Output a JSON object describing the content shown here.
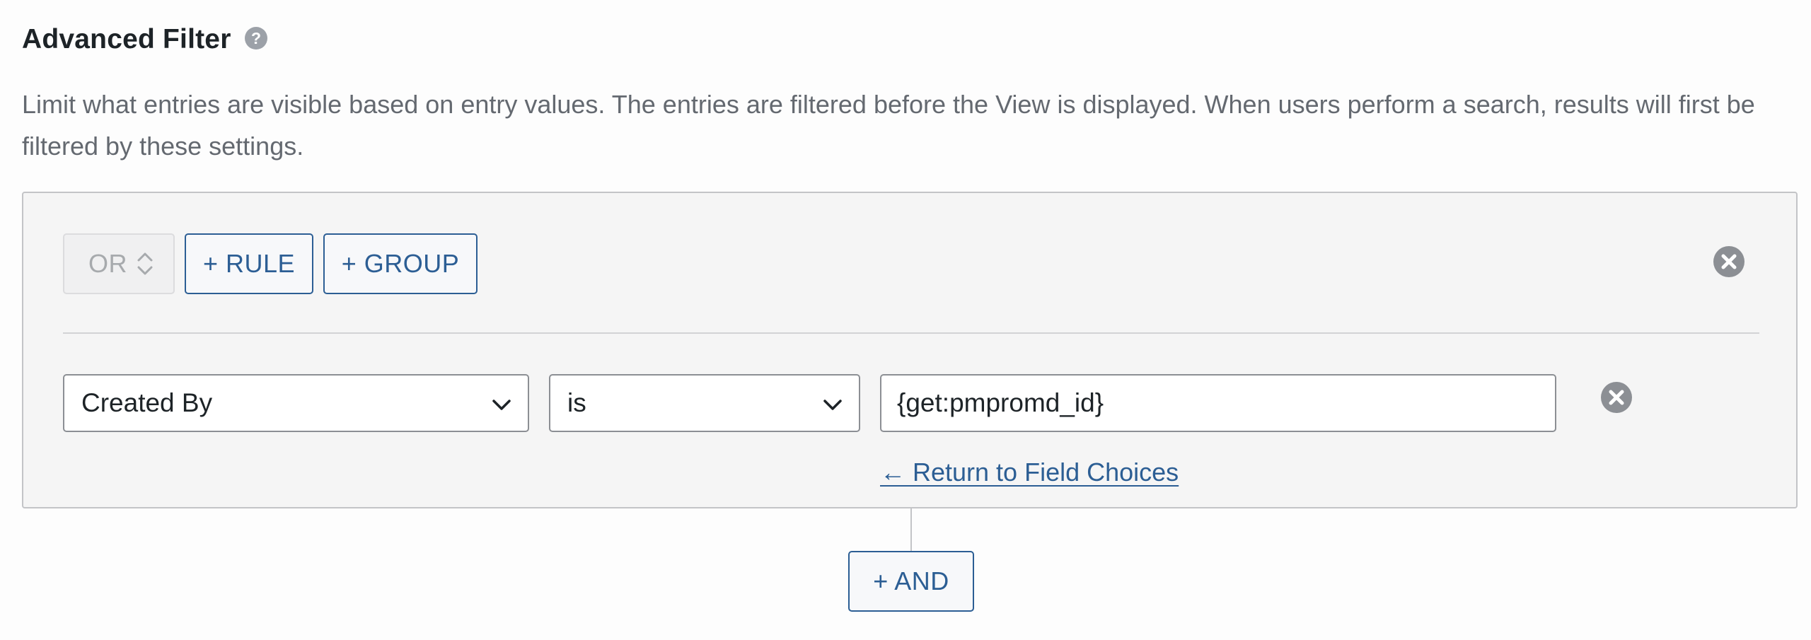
{
  "header": {
    "title": "Advanced Filter",
    "help_icon": "question-circle-icon",
    "description": "Limit what entries are visible based on entry values. The entries are filtered before the View is displayed. When users perform a search, results will first be filtered by these settings."
  },
  "group": {
    "logic_label": "OR",
    "add_rule_label": "+ RULE",
    "add_group_label": "+ GROUP",
    "remove_icon": "close-circle-icon"
  },
  "rule": {
    "field_value": "Created By",
    "operator_value": "is",
    "input_value": "{get:pmpromd_id}",
    "remove_icon": "close-circle-icon",
    "return_link": "← Return to Field Choices"
  },
  "footer": {
    "add_and_label": "+ AND"
  },
  "colors": {
    "accent": "#2c5e94",
    "muted_text": "#646970",
    "box_background": "#f5f5f5",
    "border": "#c3c4c7"
  }
}
